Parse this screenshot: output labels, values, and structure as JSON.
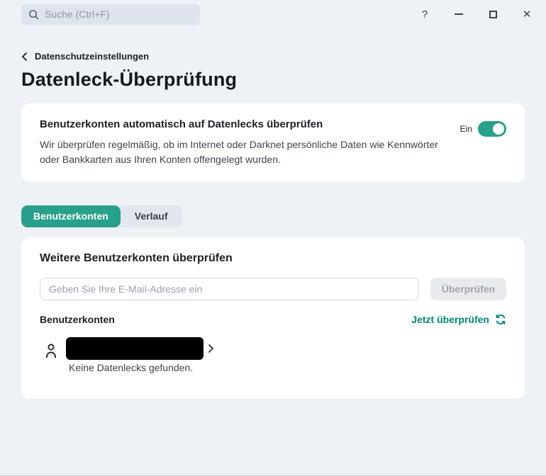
{
  "window": {
    "search_placeholder": "Suche (Ctrl+F)",
    "controls": {
      "help": "?",
      "close": "✕"
    }
  },
  "header": {
    "breadcrumb": "Datenschutzeinstellungen",
    "title": "Datenleck-Überprüfung"
  },
  "auto_check_card": {
    "title": "Benutzerkonten automatisch auf Datenlecks überprüfen",
    "description": "Wir überprüfen regelmäßig, ob im Internet oder Darknet persönliche Daten wie Kennwörter oder Bankkarten aus Ihren Konten offengelegt wurden.",
    "toggle_label": "Ein",
    "toggle_state": "on"
  },
  "tabs": [
    {
      "label": "Benutzerkonten",
      "active": true
    },
    {
      "label": "Verlauf",
      "active": false
    }
  ],
  "check_card": {
    "title": "Weitere Benutzerkonten überprüfen",
    "email_placeholder": "Geben Sie Ihre E-Mail-Adresse ein",
    "check_button": "Überprüfen",
    "accounts_label": "Benutzerkonten",
    "check_now_link": "Jetzt überprüfen",
    "account": {
      "email_redacted": true,
      "status": "Keine Datenlecks gefunden."
    }
  },
  "colors": {
    "accent_teal": "#29a08b",
    "link_teal": "#00857a",
    "background": "#eef1f6",
    "card": "#ffffff"
  }
}
